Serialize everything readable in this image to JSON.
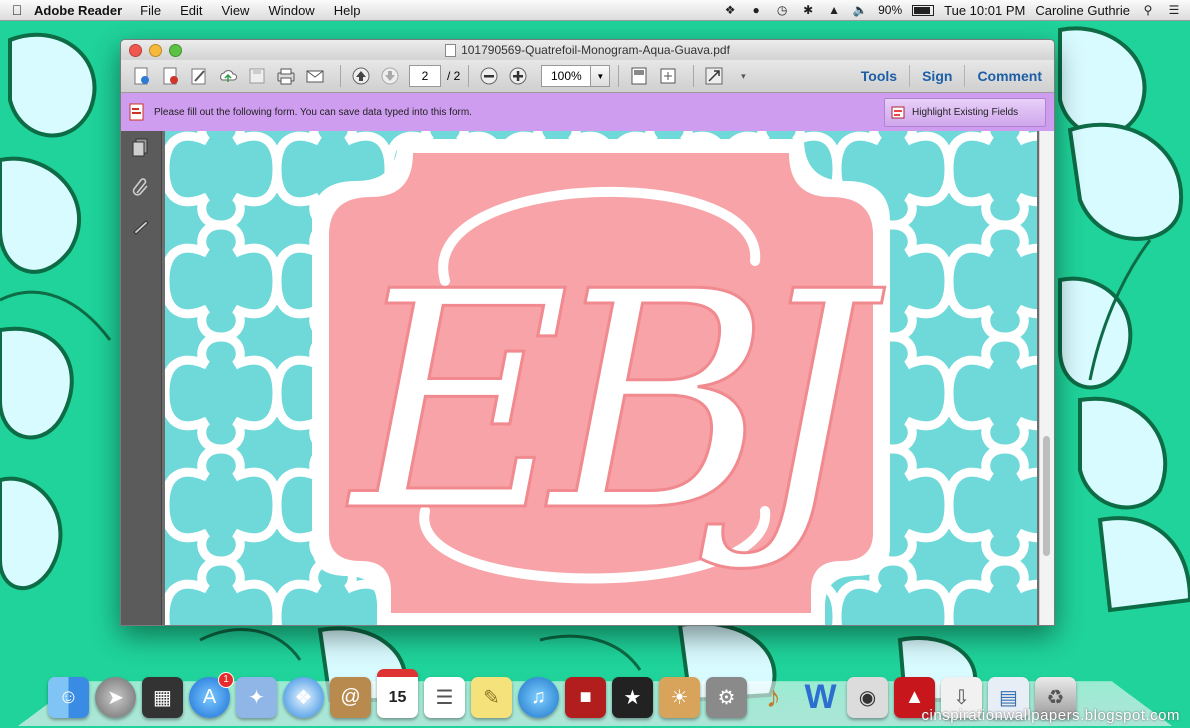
{
  "menubar": {
    "app_name": "Adobe Reader",
    "menus": [
      "File",
      "Edit",
      "View",
      "Window",
      "Help"
    ],
    "battery": "90%",
    "clock": "Tue 10:01 PM",
    "user": "Caroline Guthrie"
  },
  "window": {
    "title": "101790569-Quatrefoil-Monogram-Aqua-Guava.pdf",
    "toolbar": {
      "page_current": "2",
      "page_total": "/ 2",
      "zoom": "100%",
      "tools_label": "Tools",
      "sign_label": "Sign",
      "comment_label": "Comment"
    },
    "formbar": {
      "message": "Please fill out the following form. You can save data typed into this form.",
      "highlight_button": "Highlight Existing Fields"
    },
    "document": {
      "monogram": "EBJ",
      "background_color": "#6ed9d8",
      "panel_color": "#f7a3a7"
    }
  },
  "dock": {
    "items": [
      "Finder",
      "Launchpad",
      "Mission Control",
      "App Store",
      "Preview",
      "Safari",
      "Contacts",
      "Calendar",
      "Reminders",
      "Stickies",
      "iTunes",
      "Photo Booth",
      "iMovie",
      "iPhoto",
      "System Preferences",
      "GarageBand",
      "Microsoft Word",
      "FaceTime",
      "Adobe Reader",
      "Downloads",
      "Documents",
      "Trash"
    ],
    "calendar_day": "15",
    "app_store_badge": "1"
  },
  "watermark": "cinspirationwallpapers.blogspot.com"
}
